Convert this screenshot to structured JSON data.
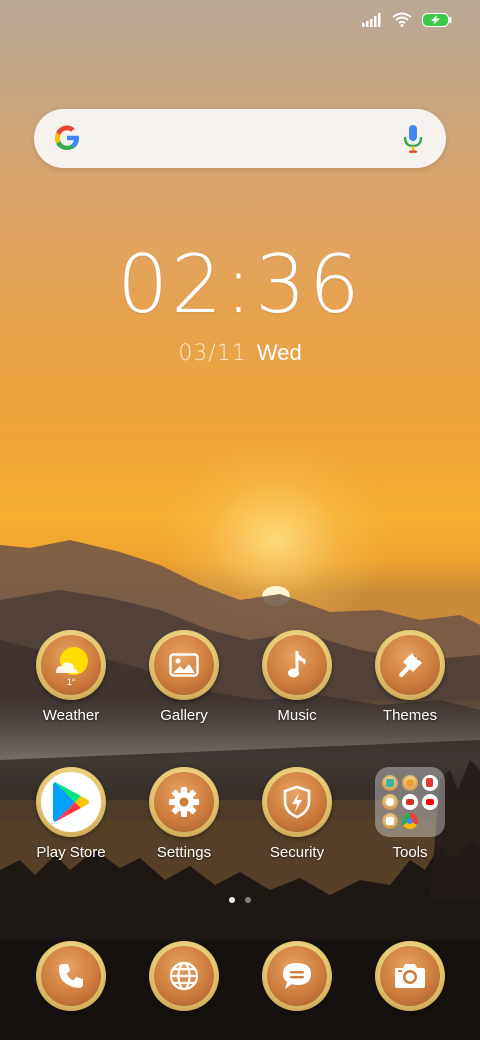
{
  "status_bar": {
    "signal_icon": "signal-bars-icon",
    "wifi_icon": "wifi-icon",
    "battery_icon": "battery-charging-icon"
  },
  "search": {
    "google_icon": "google-g-icon",
    "mic_icon": "microphone-icon"
  },
  "clock": {
    "time": "02:36",
    "date": "03/11",
    "weekday": "Wed"
  },
  "apps": [
    {
      "label": "Weather",
      "icon": "weather-icon",
      "temp": "1°"
    },
    {
      "label": "Gallery",
      "icon": "image-icon"
    },
    {
      "label": "Music",
      "icon": "music-note-icon"
    },
    {
      "label": "Themes",
      "icon": "paintbrush-icon"
    },
    {
      "label": "Play Store",
      "icon": "play-store-icon"
    },
    {
      "label": "Settings",
      "icon": "gear-icon"
    },
    {
      "label": "Security",
      "icon": "shield-lightning-icon"
    },
    {
      "label": "Tools",
      "icon": "folder-icon"
    }
  ],
  "dock": [
    {
      "icon": "phone-icon"
    },
    {
      "icon": "globe-icon"
    },
    {
      "icon": "message-icon"
    },
    {
      "icon": "camera-icon"
    }
  ],
  "page_indicator": {
    "pages": 2,
    "active": 1
  },
  "colors": {
    "sky_top": "#b8a894",
    "sky_sun": "#f6ae30",
    "mountain_dark": "#3a2f2a",
    "icon_ring": "#e4c871",
    "icon_fill": "#cd7c3c"
  }
}
